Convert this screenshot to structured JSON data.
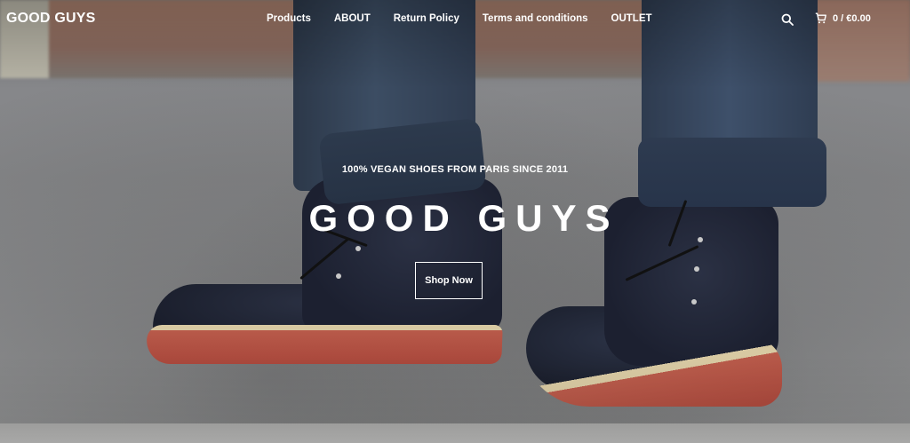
{
  "header": {
    "logo": "GOOD GUYS",
    "nav": [
      "Products",
      "ABOUT",
      "Return Policy",
      "Terms and conditions",
      "OUTLET"
    ],
    "search_icon": "search-icon",
    "cart_icon": "cart-icon",
    "cart_summary": "0 / €0.00"
  },
  "hero": {
    "subtitle": "100% VEGAN SHOES FROM PARIS SINCE 2011",
    "title": "GOOD GUYS",
    "cta_label": "Shop Now"
  },
  "colors": {
    "text": "#ffffff",
    "jeans": "#34445a",
    "boot": "#1f2433",
    "sole": "#b85a4a"
  }
}
